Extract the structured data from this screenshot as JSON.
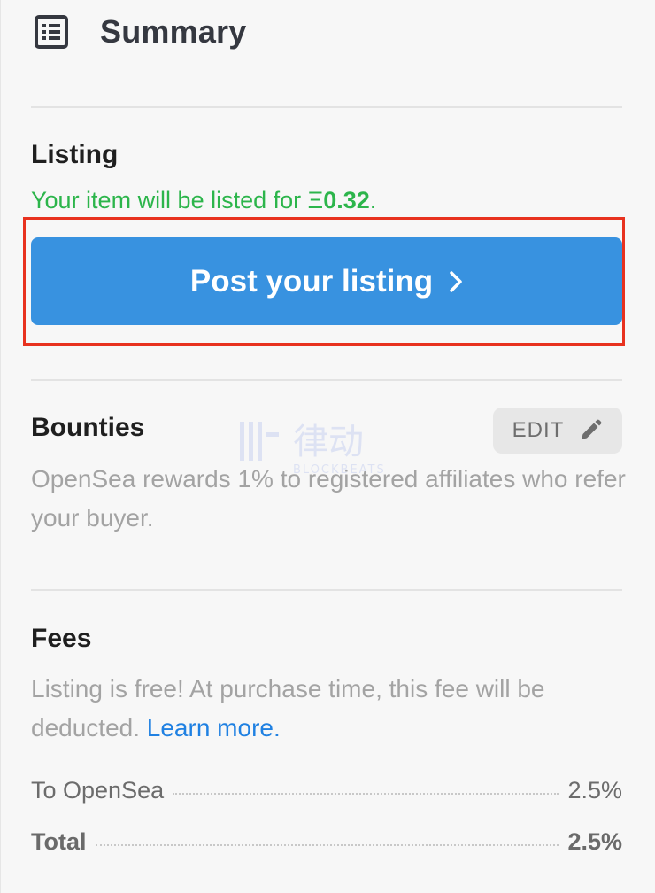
{
  "header": {
    "title": "Summary",
    "icon": "list-document-icon"
  },
  "listing": {
    "title": "Listing",
    "price_prefix": "Your item will be listed for ",
    "currency_symbol": "Ξ",
    "price": "0.32",
    "price_suffix": ".",
    "post_button_label": "Post your listing",
    "post_button_color": "#3892e0",
    "price_color": "#2cb54b",
    "highlight_color": "#e8321f"
  },
  "bounties": {
    "title": "Bounties",
    "edit_label": "EDIT",
    "description": "OpenSea rewards 1% to registered affiliates who refer your buyer."
  },
  "fees": {
    "title": "Fees",
    "description": "Listing is free! At purchase time, this fee will be deducted.",
    "learn_more": "Learn more.",
    "rows": [
      {
        "label": "To OpenSea",
        "value": "2.5%"
      },
      {
        "label": "Total",
        "value": "2.5%"
      }
    ]
  },
  "watermark": {
    "text": "律动",
    "subtext": "BLOCKBEATS"
  }
}
